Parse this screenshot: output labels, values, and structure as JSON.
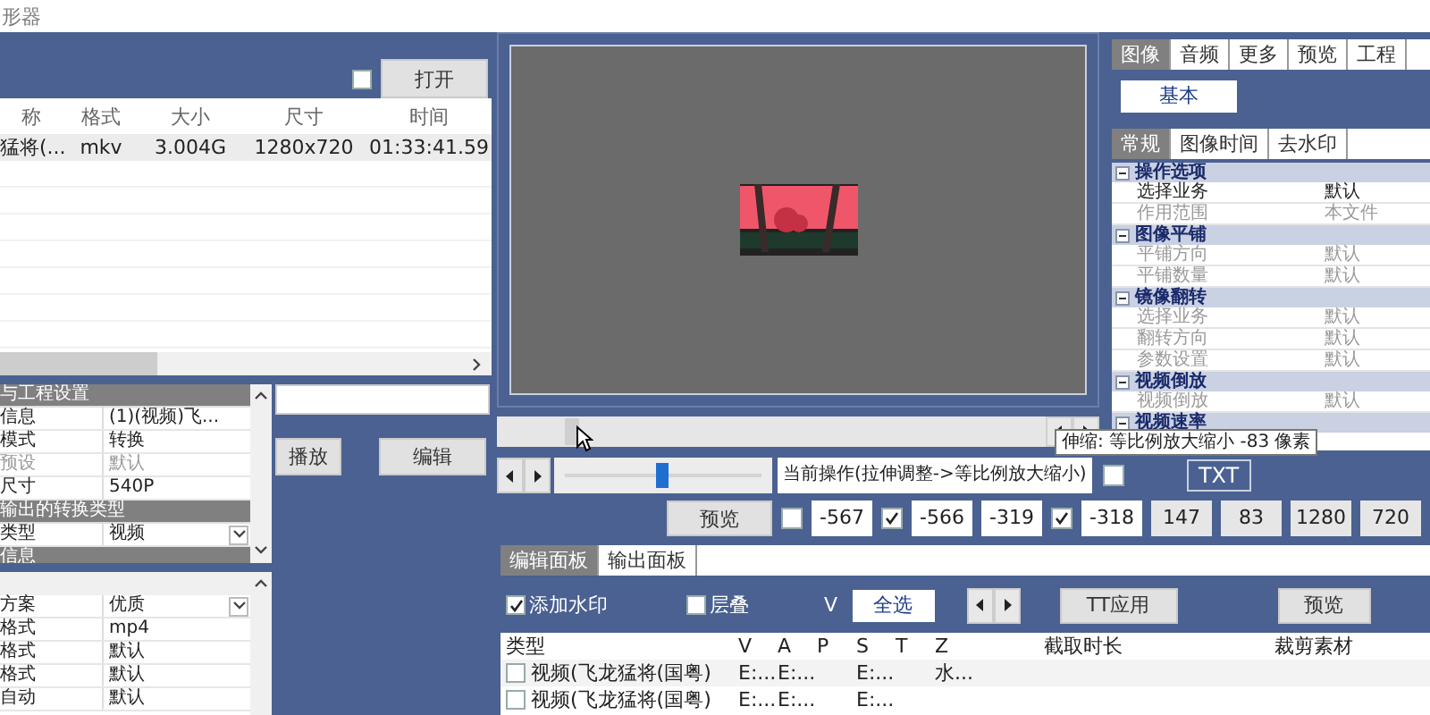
{
  "window": {
    "title": "形器"
  },
  "file_panel": {
    "open_checkbox": {
      "checked": false
    },
    "open_button": "打开",
    "columns": [
      "称",
      "格式",
      "大小",
      "尺寸",
      "时间"
    ],
    "rows": [
      {
        "cells": [
          "猛将(...",
          "mkv",
          "3.004G",
          "1280x720",
          "01:33:41.59"
        ],
        "selected": true
      }
    ]
  },
  "project_grid": {
    "rows": [
      {
        "kind": "category",
        "label": "与工程设置"
      },
      {
        "kind": "field",
        "label": "信息",
        "value": "(1)(视频)飞...",
        "disabled": false
      },
      {
        "kind": "field",
        "label": "模式",
        "value": "转换",
        "disabled": false
      },
      {
        "kind": "field",
        "label": "预设",
        "value": "默认",
        "disabled": true
      },
      {
        "kind": "field",
        "label": "尺寸",
        "value": "540P",
        "disabled": false
      },
      {
        "kind": "category",
        "label": "输出的转换类型"
      },
      {
        "kind": "dropdown",
        "label": "类型",
        "value": "视频",
        "disabled": false
      },
      {
        "kind": "category",
        "label": "信息"
      }
    ]
  },
  "scheme_grid": {
    "rows": [
      {
        "kind": "dropdown",
        "label": "方案",
        "value": "优质",
        "disabled": false
      },
      {
        "kind": "field",
        "label": "格式",
        "value": "mp4",
        "disabled": false
      },
      {
        "kind": "field",
        "label": "格式",
        "value": "默认",
        "disabled": false
      },
      {
        "kind": "field",
        "label": "格式",
        "value": "默认",
        "disabled": false
      },
      {
        "kind": "field",
        "label": "自动",
        "value": "默认",
        "disabled": false
      }
    ]
  },
  "play_button": "播放",
  "edit_button": "编辑",
  "right_panel": {
    "tabs": [
      {
        "label": "图像",
        "selected": true
      },
      {
        "label": "音频",
        "selected": false
      },
      {
        "label": "更多",
        "selected": false
      },
      {
        "label": "预览",
        "selected": false
      },
      {
        "label": "工程",
        "selected": false
      }
    ],
    "basic_button": "基本",
    "subtabs": [
      {
        "label": "常规",
        "selected": true
      },
      {
        "label": "图像时间",
        "selected": false
      },
      {
        "label": "去水印",
        "selected": false
      }
    ],
    "groups": [
      {
        "title": "操作选项",
        "expanded": true,
        "rows": [
          {
            "label": "选择业务",
            "value": "默认",
            "disabled": false
          },
          {
            "label": "作用范围",
            "value": "本文件",
            "disabled": true
          }
        ]
      },
      {
        "title": "图像平铺",
        "expanded": true,
        "rows": [
          {
            "label": "平铺方向",
            "value": "默认",
            "disabled": true
          },
          {
            "label": "平铺数量",
            "value": "默认",
            "disabled": true
          }
        ]
      },
      {
        "title": "镜像翻转",
        "expanded": true,
        "rows": [
          {
            "label": "选择业务",
            "value": "默认",
            "disabled": true
          },
          {
            "label": "翻转方向",
            "value": "默认",
            "disabled": true
          },
          {
            "label": "参数设置",
            "value": "默认",
            "disabled": true
          }
        ]
      },
      {
        "title": "视频倒放",
        "expanded": true,
        "rows": [
          {
            "label": "视频倒放",
            "value": "默认",
            "disabled": true
          }
        ]
      },
      {
        "title": "视频速率",
        "expanded": true
      }
    ]
  },
  "tooltip": "伸缩: 等比例放大缩小 -83 像素",
  "zoom_slider": {
    "level": 0.49
  },
  "operation_label": "当前操作(拉伸调整->等比例放大缩小)",
  "operation_checkbox": {
    "checked": false
  },
  "txt_button": "TXT",
  "preview_button": "预览",
  "coords": [
    {
      "kind": "checkbox",
      "checked": false
    },
    {
      "kind": "field",
      "text": "-567"
    },
    {
      "kind": "checkbox",
      "checked": true
    },
    {
      "kind": "field",
      "text": "-566"
    },
    {
      "kind": "field",
      "text": "-319"
    },
    {
      "kind": "checkbox",
      "checked": true
    },
    {
      "kind": "field",
      "text": "-318"
    },
    {
      "kind": "readonly",
      "text": "147"
    },
    {
      "kind": "readonly",
      "text": "83"
    },
    {
      "kind": "readonly",
      "text": "1280"
    },
    {
      "kind": "readonly",
      "text": "720"
    }
  ],
  "bottom_tabs": [
    {
      "label": "编辑面板",
      "selected": true
    },
    {
      "label": "输出面板",
      "selected": false
    }
  ],
  "edit_toolbar": {
    "watermark": {
      "label": "添加水印",
      "checked": true
    },
    "overlay": {
      "label": "层叠",
      "checked": false
    },
    "v_label": "V",
    "select_all": "全选",
    "apply_button": "TT应用",
    "preview_button": "预览"
  },
  "clip_table": {
    "columns": [
      "类型",
      "V",
      "A",
      "P",
      "S",
      "T",
      "Z",
      "截取时长",
      "裁剪素材"
    ],
    "rows": [
      {
        "checked": false,
        "cells": [
          "视频(飞龙猛将(国粤)",
          "E:...",
          "E:...",
          null,
          "E:...",
          null,
          "水...",
          null,
          null
        ]
      },
      {
        "checked": false,
        "cells": [
          "视频(飞龙猛将(国粤)",
          "E:...",
          "E:...",
          null,
          "E:...",
          null,
          null,
          null,
          null
        ]
      }
    ]
  }
}
